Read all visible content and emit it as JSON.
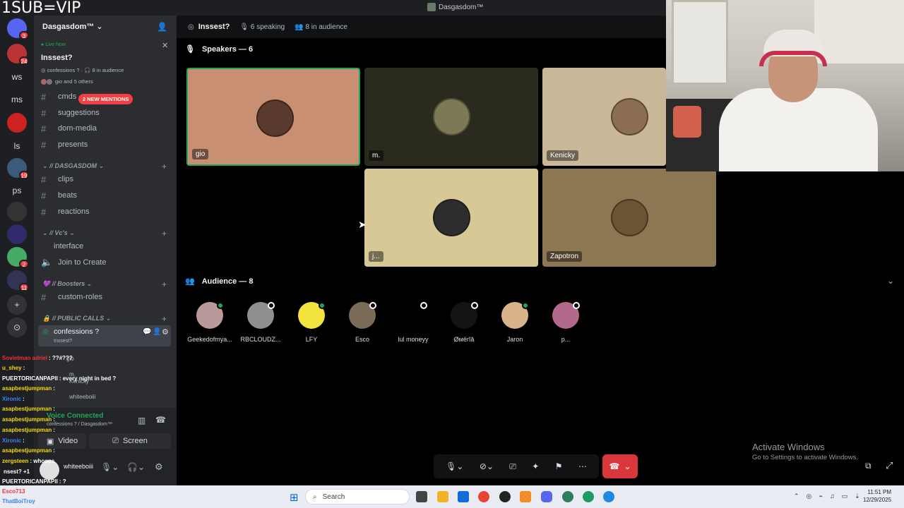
{
  "overlay": {
    "stream_text": "1SUB=VIP"
  },
  "window": {
    "title": "Dasgasdom™"
  },
  "rail": {
    "items": [
      {
        "label": "",
        "badge": "3"
      },
      {
        "label": "",
        "badge": "24"
      },
      {
        "label": "ws",
        "badge": ""
      },
      {
        "label": "ms",
        "badge": ""
      },
      {
        "label": "",
        "badge": ""
      },
      {
        "label": "ls",
        "badge": ""
      },
      {
        "label": "",
        "badge": "19"
      },
      {
        "label": "ps",
        "badge": ""
      },
      {
        "label": "",
        "badge": ""
      },
      {
        "label": "",
        "badge": ""
      },
      {
        "label": "",
        "badge": "2"
      },
      {
        "label": "",
        "badge": "11"
      }
    ]
  },
  "sidebar": {
    "server_name": "Dasgasdom™",
    "live": {
      "status": "Live Now",
      "title": "Inssest?",
      "channel": "confessions ?",
      "audience": "8 in audience",
      "people": "gio and 5 others"
    },
    "mentions_pill": "2 NEW MENTIONS",
    "channels_top": [
      "cmds",
      "suggestions",
      "dom-media",
      "presents"
    ],
    "cat_dasgasdom": "// DASGASDOM",
    "channels_dasgasdom": [
      "clips",
      "beats",
      "reactions"
    ],
    "cat_vcs": "// Vc's",
    "channels_vcs": [
      "interface",
      "Join to Create"
    ],
    "cat_boosters": "// Boosters",
    "channels_boosters": [
      "custom-roles"
    ],
    "cat_public": "// PUBLIC CALLS",
    "active_channel": "confessions ?",
    "active_sub": "Inssest?",
    "members": [
      "gio",
      "m.",
      "Kenicky",
      "whiteeboiii"
    ],
    "voice_status": "Voice Connected",
    "voice_sub": "confessions ? / Dasgasdom™",
    "video_label": "Video",
    "screen_label": "Screen",
    "user_name": "whiteeboiii"
  },
  "stage": {
    "topic": "Inssest?",
    "speaking": "6 speaking",
    "audience": "8 in audience",
    "speakers_header": "Speakers — 6",
    "audience_header": "Audience — 8",
    "speakers": [
      {
        "name": "gio",
        "bg": "#c98f72",
        "av": "#5a3a2c"
      },
      {
        "name": "m.",
        "bg": "#2b2a1f",
        "av": "#7b7a55"
      },
      {
        "name": "Kenicky",
        "bg": "#c9b798",
        "av": "#8a6d52"
      },
      {
        "name": "j...",
        "bg": "#d6c996",
        "av": "#2d2d2d"
      },
      {
        "name": "Zapotron",
        "bg": "#8d7652",
        "av": "#6b5431"
      }
    ],
    "audience_members": [
      {
        "name": "Geekedofmya...",
        "color": "#b89a9a",
        "status": "online"
      },
      {
        "name": "RBCLOUDZ...",
        "color": "#8f8f8f",
        "status": "offline"
      },
      {
        "name": "LFY",
        "color": "#f2e33d",
        "status": "online"
      },
      {
        "name": "Esco",
        "color": "#7a6a58",
        "status": "offline"
      },
      {
        "name": "lul moneyy",
        "color": "#000000",
        "status": "offline"
      },
      {
        "name": "Øмёrĭă",
        "color": "#141414",
        "status": "offline"
      },
      {
        "name": "Jaron",
        "color": "#d9b38c",
        "status": "online"
      },
      {
        "name": "p...",
        "color": "#b36a8a",
        "status": "offline"
      }
    ]
  },
  "watermark": {
    "line1": "Activate Windows",
    "line2": "Go to Settings to activate Windows."
  },
  "taskbar": {
    "search": "Search",
    "time": "11:51 PM",
    "date": "12/29/2025"
  },
  "chat": [
    {
      "user": "Sovietman adriel",
      "msg": ": ??#???",
      "color": "#e33"
    },
    {
      "user": "u_shey",
      "msg": ":",
      "color": "#f5d90a"
    },
    {
      "user": "PUERTORICANPAPII",
      "msg": ": every night in bed ?",
      "color": "#fff"
    },
    {
      "user": "asapbestjumpman",
      "msg": ":",
      "color": "#f5d90a"
    },
    {
      "user": "Xironic",
      "msg": ":",
      "color": "#3b82f6"
    },
    {
      "user": "asapbestjumpman",
      "msg": ":",
      "color": "#f5d90a"
    },
    {
      "user": "asapbestjumpman",
      "msg": ":",
      "color": "#f5d90a"
    },
    {
      "user": "asapbestjumpman",
      "msg": ":",
      "color": "#f5d90a"
    },
    {
      "user": "Xironic",
      "msg": ":",
      "color": "#3b82f6"
    },
    {
      "user": "asapbestjumpman",
      "msg": ":",
      "color": "#f5d90a"
    },
    {
      "user": "zergsteen",
      "msg": ": whoops",
      "color": "#f5d90a"
    },
    {
      "user": "",
      "msg": "nsest? +1",
      "color": "#fff"
    },
    {
      "user": "PUERTORICANPAPII",
      "msg": ": ?",
      "color": "#fff"
    },
    {
      "user": "Esco713",
      "msg": ":",
      "color": "#e33"
    },
    {
      "user": "ThatBoiTroy",
      "msg": ":",
      "color": "#3b82f6"
    }
  ]
}
